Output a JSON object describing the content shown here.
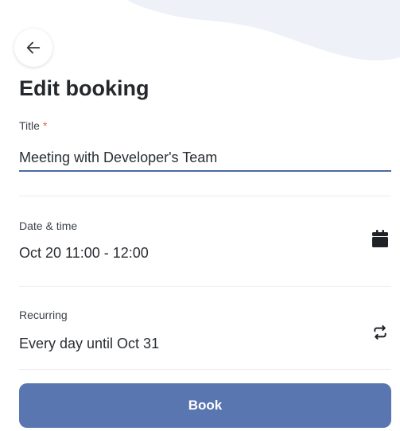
{
  "header": {
    "title": "Edit booking"
  },
  "form": {
    "title_label": "Title",
    "required_marker": "*",
    "title_value": "Meeting with Developer's Team",
    "date_time": {
      "label": "Date & time",
      "value": "Oct 20 11:00 - 12:00",
      "icon": "calendar-icon"
    },
    "recurring": {
      "label": "Recurring",
      "value": "Every day until Oct 31",
      "icon": "repeat-icon"
    }
  },
  "actions": {
    "book_label": "Book"
  },
  "colors": {
    "primary": "#5a76b0",
    "input_underline": "#4a6aa5",
    "required": "#e0683a",
    "wave": "#eef1f8"
  }
}
